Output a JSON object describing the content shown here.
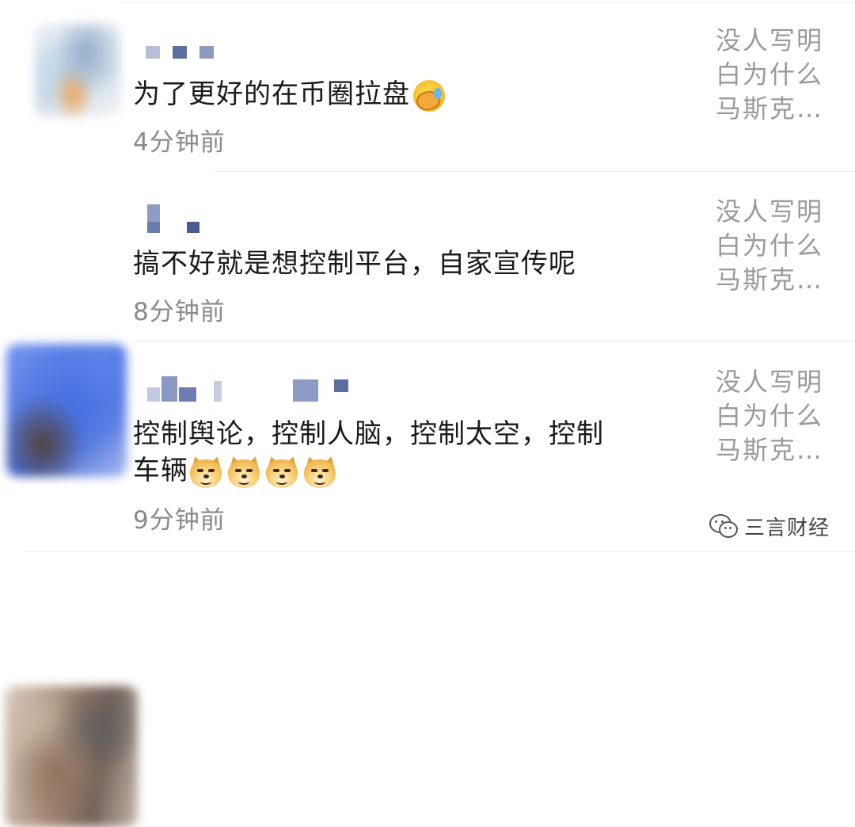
{
  "comments": [
    {
      "text": "为了更好的在币圈拉盘",
      "emoji": "facepalm-emoji",
      "time": "4分钟前",
      "side_lines": [
        "没人写明",
        "白为什么",
        "马斯克…"
      ]
    },
    {
      "text": "搞不好就是想控制平台，自家宣传呢",
      "time": "8分钟前",
      "side_lines": [
        "没人写明",
        "白为什么",
        "马斯克…"
      ]
    },
    {
      "text_line1": "控制舆论，控制人脑，控制太空，控制",
      "text_line2": "车辆",
      "emoji": "doge-emoji",
      "emoji_count": 4,
      "time": "9分钟前",
      "side_lines": [
        "没人写明",
        "白为什么",
        "马斯克…"
      ]
    }
  ],
  "watermark": {
    "icon": "wechat-icon",
    "text": "三言财经"
  },
  "colors": {
    "text": "#1a1a1a",
    "timestamp": "#8a8a8a",
    "side_text": "#9a9a9a",
    "mosaic": "#5a6a9a"
  }
}
